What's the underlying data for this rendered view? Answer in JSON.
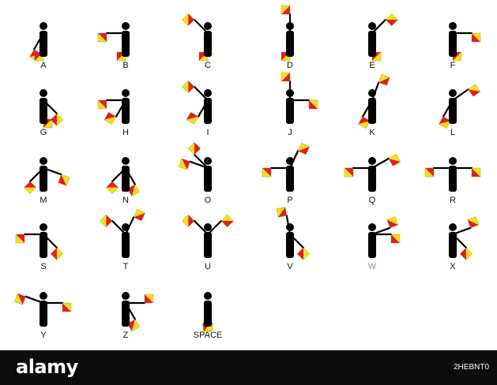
{
  "colors": {
    "red": "#e51b1f",
    "yellow": "#f4e21a",
    "body": "#000000",
    "background": "#ffffff",
    "footer": "#0c0c0c"
  },
  "letters": [
    {
      "label": "A",
      "arms": [
        -150,
        180
      ]
    },
    {
      "label": "B",
      "arms": [
        -90,
        180
      ]
    },
    {
      "label": "C",
      "arms": [
        -45,
        180
      ]
    },
    {
      "label": "D",
      "arms": [
        0,
        180
      ]
    },
    {
      "label": "E",
      "arms": [
        180,
        45
      ]
    },
    {
      "label": "F",
      "arms": [
        180,
        90
      ]
    },
    {
      "label": "G",
      "arms": [
        180,
        135
      ]
    },
    {
      "label": "H",
      "arms": [
        -90,
        -150
      ]
    },
    {
      "label": "I",
      "arms": [
        -45,
        -150
      ]
    },
    {
      "label": "J",
      "arms": [
        0,
        90
      ]
    },
    {
      "label": "K",
      "arms": [
        -150,
        20
      ]
    },
    {
      "label": "L",
      "arms": [
        -150,
        55
      ]
    },
    {
      "label": "M",
      "arms": [
        -135,
        110
      ]
    },
    {
      "label": "N",
      "arms": [
        -135,
        150
      ]
    },
    {
      "label": "O",
      "arms": [
        -70,
        -45
      ]
    },
    {
      "label": "P",
      "arms": [
        -90,
        25
      ]
    },
    {
      "label": "Q",
      "arms": [
        -90,
        60
      ]
    },
    {
      "label": "R",
      "arms": [
        -90,
        90
      ]
    },
    {
      "label": "S",
      "arms": [
        -90,
        135
      ]
    },
    {
      "label": "T",
      "arms": [
        -45,
        25
      ]
    },
    {
      "label": "U",
      "arms": [
        -45,
        45
      ]
    },
    {
      "label": "V",
      "arms": [
        -10,
        135
      ]
    },
    {
      "label": "W",
      "arms": [
        70,
        90
      ],
      "label_color": "#8a8a8a"
    },
    {
      "label": "X",
      "arms": [
        70,
        135
      ]
    },
    {
      "label": "Y",
      "arms": [
        -70,
        90
      ]
    },
    {
      "label": "Z",
      "arms": [
        90,
        150
      ]
    },
    {
      "label": "SPACE",
      "arms": [
        -170,
        170
      ]
    }
  ],
  "footer": {
    "brand": "alamy",
    "image_id": "2HEBNT0"
  }
}
